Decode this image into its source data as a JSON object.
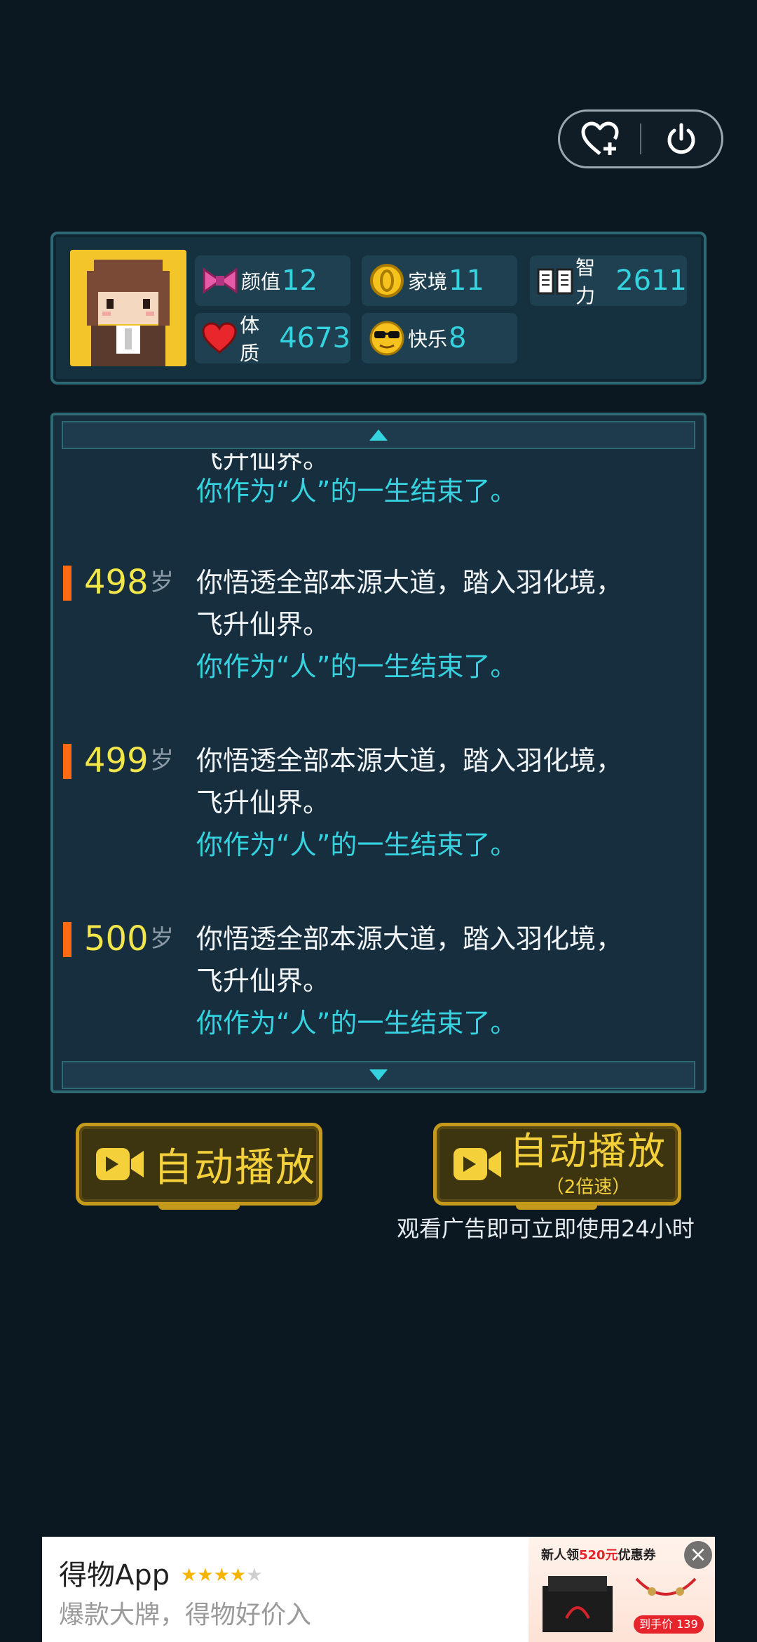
{
  "stats": [
    {
      "icon": "bow-icon",
      "label": "颜值",
      "value": "12"
    },
    {
      "icon": "coin-icon",
      "label": "家境",
      "value": "11"
    },
    {
      "icon": "book-icon",
      "label": "智力",
      "value": "2611"
    },
    {
      "icon": "heart-icon",
      "label": "体质",
      "value": "4673"
    },
    {
      "icon": "sunglasses-face-icon",
      "label": "快乐",
      "value": "8"
    }
  ],
  "log": {
    "partial_top": "飞升仙界。",
    "partial_end": "你作为“人”的一生结束了。",
    "age_unit": "岁",
    "entries": [
      {
        "age": "498",
        "line1": "你悟透全部本源大道，踏入羽化境，",
        "line2": "飞升仙界。",
        "line3": "你作为“人”的一生结束了。"
      },
      {
        "age": "499",
        "line1": "你悟透全部本源大道，踏入羽化境，",
        "line2": "飞升仙界。",
        "line3": "你作为“人”的一生结束了。"
      },
      {
        "age": "500",
        "line1": "你悟透全部本源大道，踏入羽化境，",
        "line2": "飞升仙界。",
        "line3": "你作为“人”的一生结束了。"
      }
    ]
  },
  "buttons": {
    "autoplay": "自动播放",
    "autoplay2x": "自动播放",
    "autoplay2x_sub": "（2倍速）"
  },
  "hint": "观看广告即可立即使用24小时",
  "ad": {
    "app_name": "得物App",
    "rating_stars": "★★★★",
    "rating_off": "★",
    "slogan": "爆款大牌，得物好价入",
    "banner_prefix": "新人领",
    "banner_amount": "520元",
    "banner_suffix": "优惠券",
    "price": "到手价 139"
  },
  "colors": {
    "background": "#0b1822",
    "accent_cyan": "#35d3e0",
    "age_yellow": "#f2e64a",
    "marker_orange": "#ff6a13",
    "button_gold": "#c59a1c"
  }
}
